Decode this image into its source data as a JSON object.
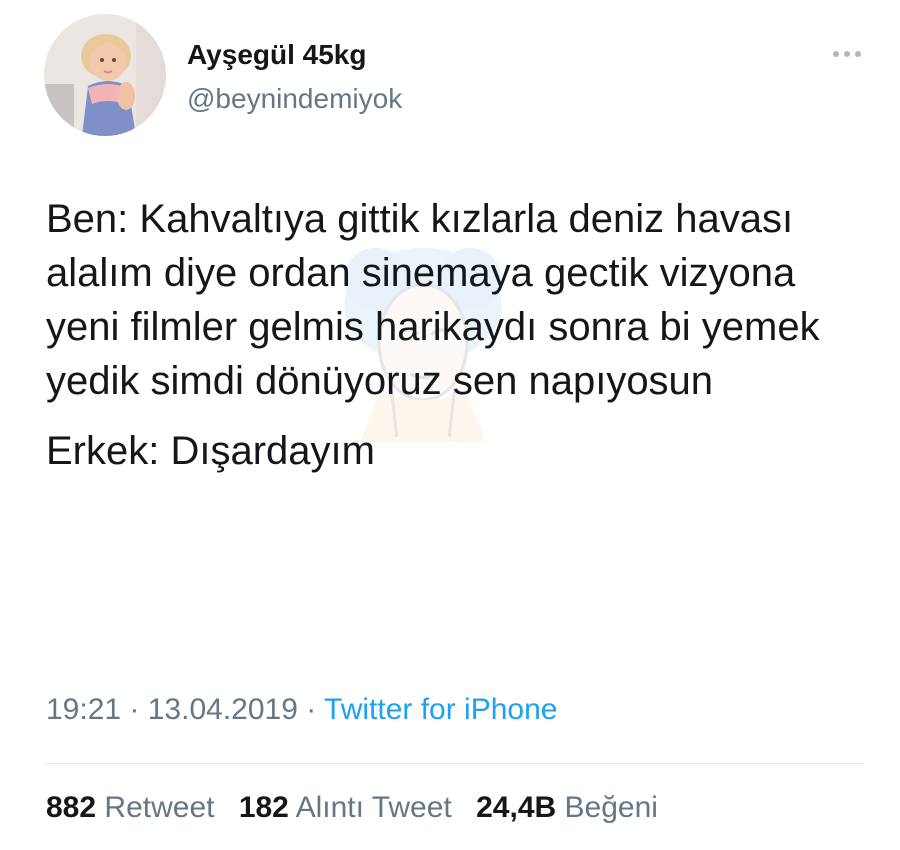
{
  "tweet": {
    "author": {
      "display_name": "Ayşegül 45kg",
      "handle": "@beynindemiyok",
      "avatar_icon": "avatar-photo-child"
    },
    "more_icon": "more-dots-icon",
    "text": {
      "paragraph1": "Ben: Kahvaltıya gittik kızlarla deniz havası alalım diye ordan sinemaya gectik vizyona yeni filmler gelmis harikaydı sonra bi yemek yedik simdi dönüyoruz sen napıyosun",
      "paragraph2": "Erkek: Dışardayım"
    },
    "meta": {
      "time": "19:21",
      "separator": " · ",
      "date": "13.04.2019",
      "source": "Twitter for iPhone"
    },
    "stats": {
      "retweet_count": "882",
      "retweet_label": "Retweet",
      "quote_count": "182",
      "quote_label": "Alıntı Tweet",
      "like_count": "24,4B",
      "like_label": "Beğeni"
    },
    "colors": {
      "text": "#14171a",
      "secondary": "#657786",
      "link": "#1da1f2",
      "divider": "#e1e8ed"
    }
  }
}
